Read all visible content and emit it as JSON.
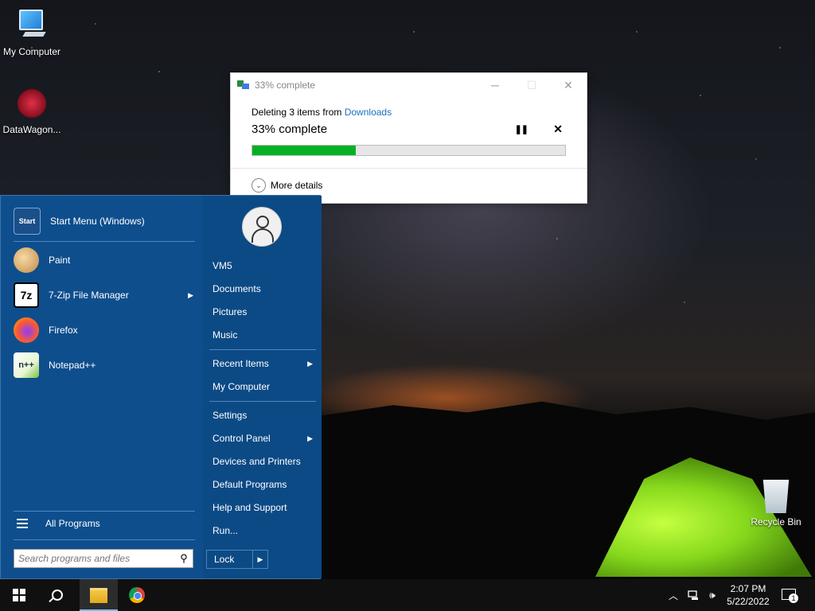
{
  "desktop": {
    "icons": [
      {
        "label": "My Computer"
      },
      {
        "label": "DataWagon..."
      },
      {
        "label": "Recycle Bin"
      }
    ]
  },
  "progress_dialog": {
    "title": "33% complete",
    "deleting_prefix": "Deleting 3 items from ",
    "location_link": "Downloads",
    "status": "33% complete",
    "progress_fraction": 0.33,
    "more_details": "More details",
    "controls": {
      "minimize": "─",
      "maximize": "☐",
      "close": "✕",
      "pause": "❚❚",
      "stop": "✕"
    }
  },
  "start_menu": {
    "pinned": [
      {
        "label": "Start Menu (Windows)",
        "icon": "start-menu-icon",
        "icon_text": "Start",
        "has_arrow": false
      },
      {
        "label": "Paint",
        "icon": "paint-icon",
        "icon_text": "",
        "has_arrow": false
      },
      {
        "label": "7-Zip File Manager",
        "icon": "7zip-icon",
        "icon_text": "7z",
        "has_arrow": true
      },
      {
        "label": "Firefox",
        "icon": "firefox-icon",
        "icon_text": "",
        "has_arrow": false
      },
      {
        "label": "Notepad++",
        "icon": "notepadpp-icon",
        "icon_text": "n++",
        "has_arrow": false
      }
    ],
    "all_programs": "All Programs",
    "search_placeholder": "Search programs and files",
    "right": {
      "user": "VM5",
      "items": [
        {
          "label": "Documents"
        },
        {
          "label": "Pictures"
        },
        {
          "label": "Music"
        },
        {
          "label": "Recent Items",
          "arrow": "▶"
        },
        {
          "label": "My Computer"
        },
        {
          "label": "Settings"
        },
        {
          "label": "Control Panel",
          "arrow": "▶"
        },
        {
          "label": "Devices and Printers"
        },
        {
          "label": "Default Programs"
        },
        {
          "label": "Help and Support"
        },
        {
          "label": "Run..."
        }
      ],
      "lock": "Lock",
      "lock_arrow": "▶"
    },
    "arrow_glyph": "▶"
  },
  "taskbar": {
    "tray_up_arrow": "︿",
    "time": "2:07 PM",
    "date": "5/22/2022",
    "notification_count": "1",
    "volume_glyph": "🕪"
  }
}
